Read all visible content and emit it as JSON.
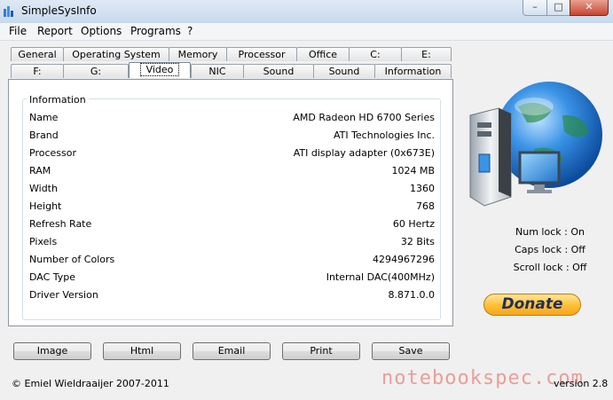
{
  "window": {
    "title": "SimpleSysInfo",
    "controls": {
      "minimize": "–",
      "maximize": "□",
      "close": "✕"
    }
  },
  "menu": [
    "File",
    "Report",
    "Options",
    "Programs",
    "?"
  ],
  "tabs_row1": [
    "General",
    "Operating System",
    "Memory",
    "Processor",
    "Office",
    "C:",
    "E:"
  ],
  "tabs_row2": [
    "F:",
    "G:",
    "Video",
    "NIC",
    "Sound",
    "Sound",
    "Information"
  ],
  "active_tab": "Video",
  "info_group": {
    "title": "Information",
    "rows": [
      {
        "label": "Name",
        "value": "AMD Radeon HD 6700 Series"
      },
      {
        "label": "Brand",
        "value": "ATI Technologies Inc."
      },
      {
        "label": "Processor",
        "value": "ATI display adapter (0x673E)"
      },
      {
        "label": "RAM",
        "value": "1024 MB"
      },
      {
        "label": "Width",
        "value": "1360"
      },
      {
        "label": "Height",
        "value": "768"
      },
      {
        "label": "Refresh Rate",
        "value": "60 Hertz"
      },
      {
        "label": "Pixels",
        "value": "32 Bits"
      },
      {
        "label": "Number of Colors",
        "value": "4294967296"
      },
      {
        "label": "DAC Type",
        "value": "Internal DAC(400MHz)"
      },
      {
        "label": "Driver Version",
        "value": "8.871.0.0"
      }
    ]
  },
  "status": {
    "num_lock": "Num lock : On",
    "caps_lock": "Caps lock : Off",
    "scroll_lock": "Scroll lock : Off"
  },
  "donate_label": "Donate",
  "buttons": [
    "Image",
    "Html",
    "Email",
    "Print",
    "Save"
  ],
  "footer": {
    "copyright": "© Emiel Wieldraaijer 2007-2011",
    "version": "version 2.8"
  },
  "watermark": "notebookspec.com",
  "colors": {
    "accent_blue": "#2f7fd6",
    "donate_orange": "#ffc23a",
    "watermark": "#e85a50"
  },
  "icons": [
    "app-icon",
    "computer-globe-icon",
    "mouse-cursor-icon"
  ]
}
